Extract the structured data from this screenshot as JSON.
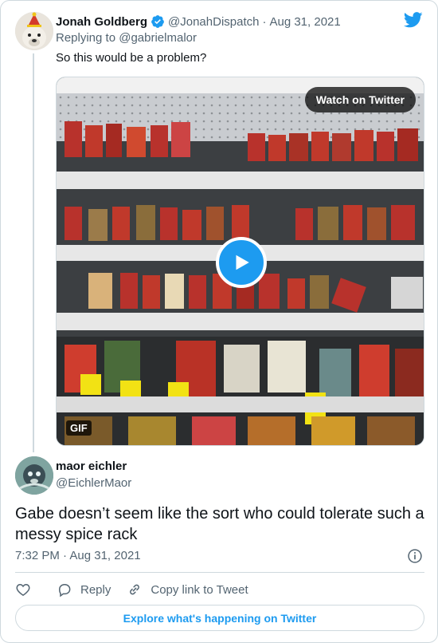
{
  "parent_tweet": {
    "author_name": "Jonah Goldberg",
    "handle": "@JonahDispatch",
    "separator": "·",
    "date": "Aug 31, 2021",
    "replying_prefix": "Replying to",
    "replying_to": "@gabrielmalor",
    "text": "So this would be a problem?",
    "media": {
      "watch_label": "Watch on Twitter",
      "gif_label": "GIF"
    }
  },
  "main_tweet": {
    "author_name": "maor eichler",
    "handle": "@EichlerMaor",
    "text": "Gabe doesn’t seem like the sort who could tolerate such a messy spice rack",
    "time": "7:32 PM",
    "separator": "·",
    "date": "Aug 31, 2021"
  },
  "actions": {
    "reply_label": "Reply",
    "copy_label": "Copy link to Tweet"
  },
  "explore_label": "Explore what's happening on Twitter",
  "colors": {
    "accent": "#1d9bf0",
    "text_secondary": "#536471",
    "border": "#cfd9de"
  },
  "icons": [
    "twitter-bird-icon",
    "verified-badge-icon",
    "play-icon",
    "info-icon",
    "heart-icon",
    "reply-bubble-icon",
    "link-icon"
  ]
}
